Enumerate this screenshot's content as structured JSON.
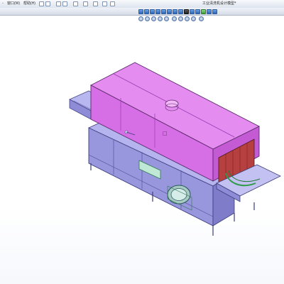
{
  "menu": {
    "items": [
      {
        "label": "窗口(W)"
      },
      {
        "label": "帮助(H)"
      }
    ]
  },
  "window": {
    "title": "工业清洗机设计模型*"
  },
  "model": {
    "label_on_box": "□"
  },
  "colors": {
    "toolbar_bg": "#e6ebf3",
    "hood": "#e173ee",
    "body": "#9d9be0",
    "chamber_red": "#c04040",
    "accent_green": "#2f9a4a"
  }
}
